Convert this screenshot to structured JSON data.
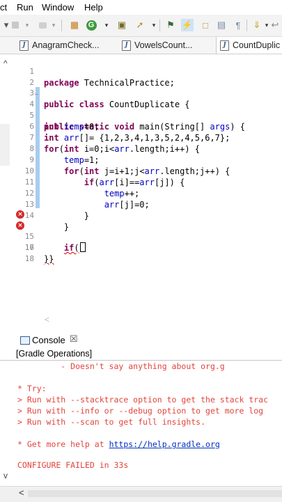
{
  "menu": {
    "items": [
      "ct",
      "Run",
      "Window",
      "Help"
    ]
  },
  "toolbar": {
    "icons": [
      "debug-icon",
      "stop-icon",
      "disconnect-icon",
      "build-icon",
      "run-icon",
      "package-icon",
      "tools-icon",
      "pin-icon",
      "highlight-icon",
      "toggle-icon",
      "doc-icon",
      "paragraph-icon",
      "annotation-icon",
      "back-icon"
    ]
  },
  "tabs": [
    {
      "label": "AnagramCheck..."
    },
    {
      "label": "VowelsCount..."
    },
    {
      "label": "CountDuplic"
    }
  ],
  "editor": {
    "lines": [
      {
        "n": "1",
        "text": "package TechnicalPractice;"
      },
      {
        "n": "2",
        "text": ""
      },
      {
        "n": "3",
        "text": "public class CountDuplicate {"
      },
      {
        "n": "4",
        "text": "public static void main(String[] args) {"
      },
      {
        "n": "5",
        "text": "int temp=0;"
      },
      {
        "n": "6",
        "text": "int arr[]= {1,2,3,4,1,3,5,2,4,5,6,7};"
      },
      {
        "n": "7",
        "text": "for(int i=0;i<arr.length;i++) {"
      },
      {
        "n": "8",
        "text": "    temp=1;"
      },
      {
        "n": "9",
        "text": "    for(int j=i+1;j<arr.length;j++) {"
      },
      {
        "n": "10",
        "text": "        if(arr[i]==arr[j]) {"
      },
      {
        "n": "11",
        "text": "            temp++;"
      },
      {
        "n": "12",
        "text": "            arr[j]=0;"
      },
      {
        "n": "13",
        "text": "        }"
      },
      {
        "n": "14",
        "text": "    }"
      },
      {
        "n": "15",
        "text": "    if("
      },
      {
        "n": "16",
        "text": "}}"
      },
      {
        "n": "17",
        "text": ""
      },
      {
        "n": "18",
        "text": ""
      }
    ],
    "scroll_left": "<"
  },
  "console": {
    "title": "Console",
    "close": "☒",
    "subtitle": "[Gradle Operations]",
    "lines": [
      "         - Doesn't say anything about org.g",
      "",
      "* Try:",
      "> Run with --stacktrace option to get the stack trac",
      "> Run with --info or --debug option to get more log",
      "> Run with --scan to get full insights.",
      "",
      "* Get more help at ",
      "",
      "CONFIGURE FAILED in 33s"
    ],
    "help_link": "https://help.gradle.org"
  },
  "nav": {
    "left_arrow": "<",
    "up_arrow": "^",
    "down_arrow": "v"
  },
  "colors": {
    "keyword": "#7f0055",
    "error": "#e2443b",
    "link": "#0030c0",
    "change_bar": "#a7cdef"
  }
}
